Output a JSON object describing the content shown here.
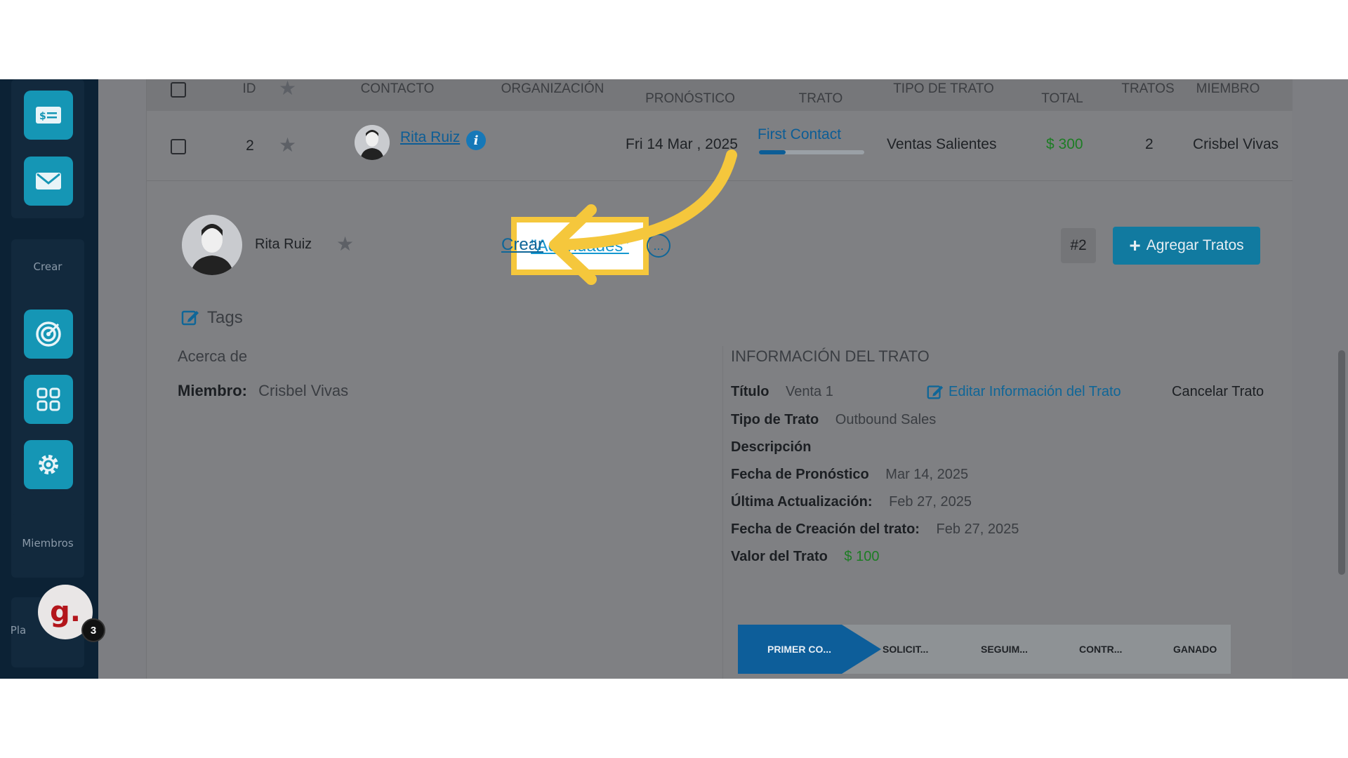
{
  "sidebar": {
    "labels": {
      "crear": "Crear",
      "miembros": "Miembros",
      "planes": "Pla"
    },
    "icons": [
      "invoice-icon",
      "mail-icon",
      "target-icon",
      "apps-grid-icon",
      "gear-icon"
    ],
    "account": {
      "logo": "g.",
      "badge": "3"
    }
  },
  "table": {
    "headers": {
      "id": "ID",
      "contacto": "CONTACTO",
      "organizacion": "ORGANIZACIÓN",
      "fecha_line2": "PRONÓSTICO",
      "etapa_line2": "TRATO",
      "tipo": "TIPO DE TRATO",
      "valor_line2": "TOTAL",
      "tratos": "TRATOS",
      "miembro": "MIEMBRO"
    },
    "row": {
      "id": "2",
      "contacto": "Rita Ruiz",
      "fecha": "Fri 14 Mar , 2025",
      "etapa": "First Contact",
      "etapa_progress": 0.25,
      "tipo": "Ventas Salientes",
      "valor": "$ 300",
      "tratos": "2",
      "miembro": "Crisbel Vivas"
    }
  },
  "detail": {
    "contact_name": "Rita Ruiz",
    "highlight_label": "\"Actividades\"",
    "crear_link": "Crear",
    "more_icon": "...",
    "deal_number": "#2",
    "add_button": "Agregar Tratos",
    "tags_label": "Tags",
    "about_label": "Acerca de",
    "member_key": "Miembro:",
    "member_value": "Crisbel Vivas"
  },
  "deal_info": {
    "heading": "INFORMACIÓN DEL TRATO",
    "titulo_key": "Título",
    "titulo_value": "Venta 1",
    "edit_link": "Editar Información del Trato",
    "cancel_link": "Cancelar Trato",
    "tipo_key": "Tipo de Trato",
    "tipo_value": "Outbound Sales",
    "descripcion_key": "Descripción",
    "fecha_key": "Fecha de Pronóstico",
    "fecha_value": "Mar 14, 2025",
    "actualizacion_key": "Última Actualización:",
    "actualizacion_value": "Feb 27, 2025",
    "creacion_key": "Fecha de Creación del trato:",
    "creacion_value": "Feb 27, 2025",
    "valor_key": "Valor del Trato",
    "valor_value": "$ 100"
  },
  "pipeline": {
    "stages": [
      "PRIMER CO...",
      "SOLICIT...",
      "SEGUIM...",
      "CONTR...",
      "GANADO"
    ],
    "active_index": 0
  },
  "colors": {
    "accent": "#1596b5",
    "highlight_border": "#f5c73c",
    "arrow": "#f5c73c"
  }
}
